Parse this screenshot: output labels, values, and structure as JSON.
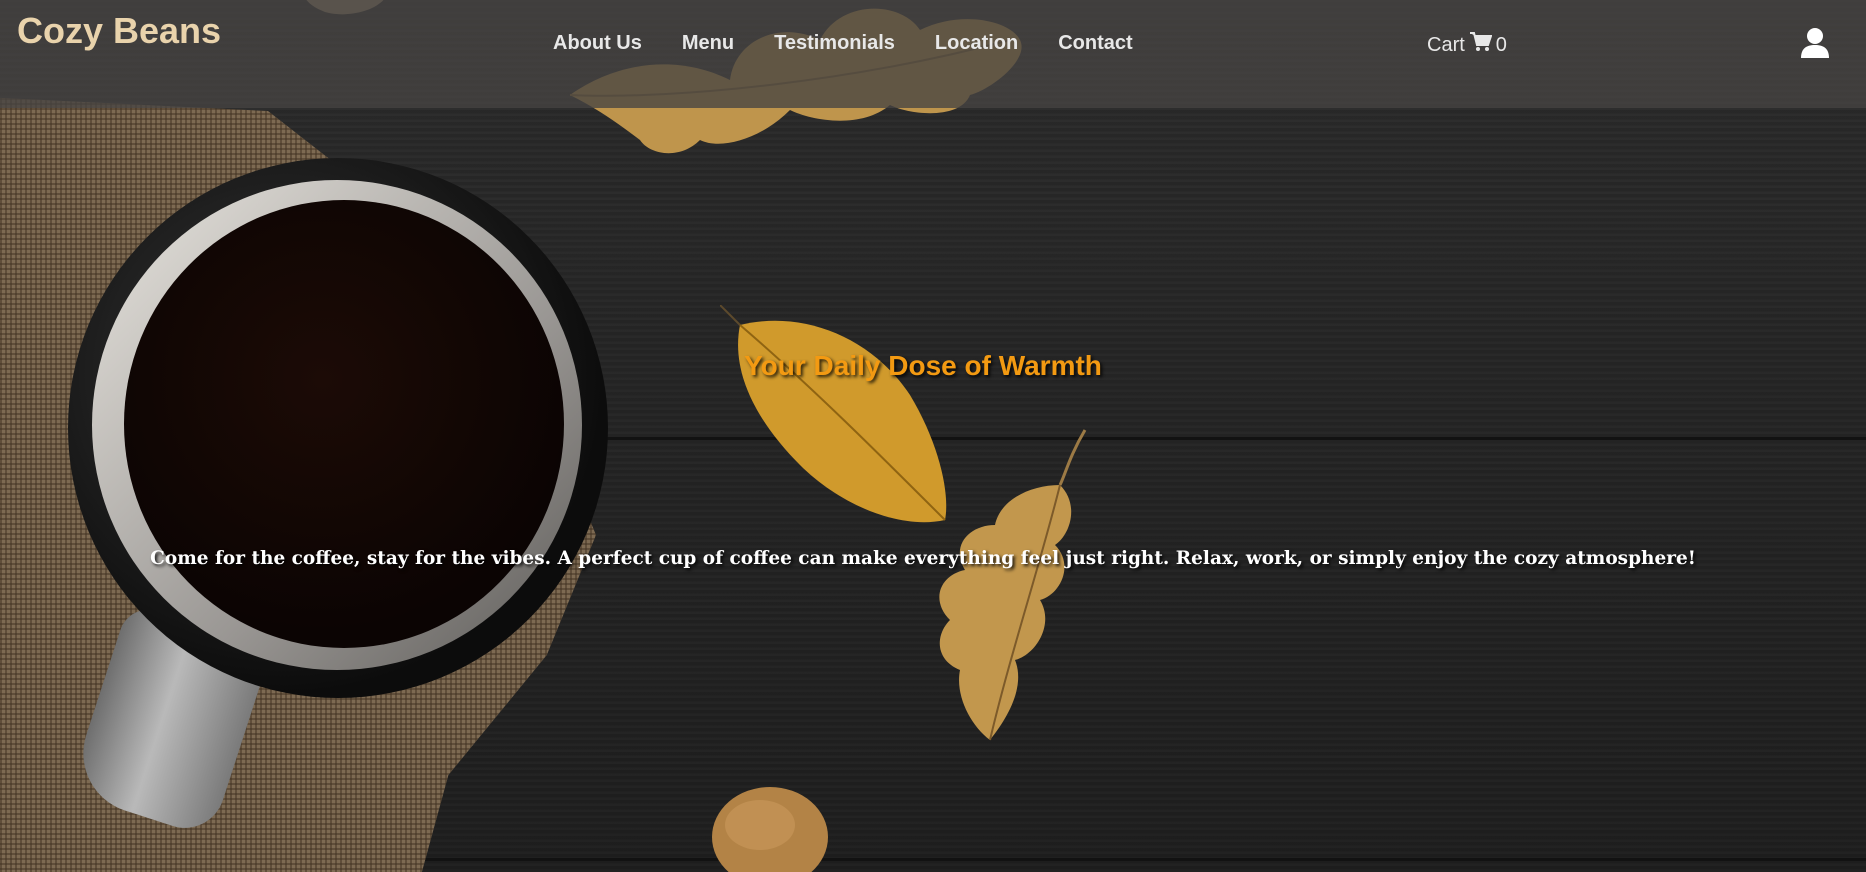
{
  "brand": {
    "name": "Cozy Beans"
  },
  "nav": {
    "links": [
      {
        "label": "About Us"
      },
      {
        "label": "Menu"
      },
      {
        "label": "Testimonials"
      },
      {
        "label": "Location"
      },
      {
        "label": "Contact"
      }
    ]
  },
  "cart": {
    "label": "Cart",
    "count": "0",
    "icon": "shopping-cart-icon"
  },
  "account": {
    "icon": "user-icon"
  },
  "hero": {
    "title": "Your Daily Dose of Warmth",
    "subtitle": "Come for the coffee, stay for the vibes. A perfect cup of coffee can make everything feel just right. Relax, work, or simply enjoy the cozy atmosphere!"
  },
  "colors": {
    "brand": "#e9d3ac",
    "accent": "#f39a12",
    "nav_bg": "#464442",
    "text_light": "#e8e8e8"
  }
}
